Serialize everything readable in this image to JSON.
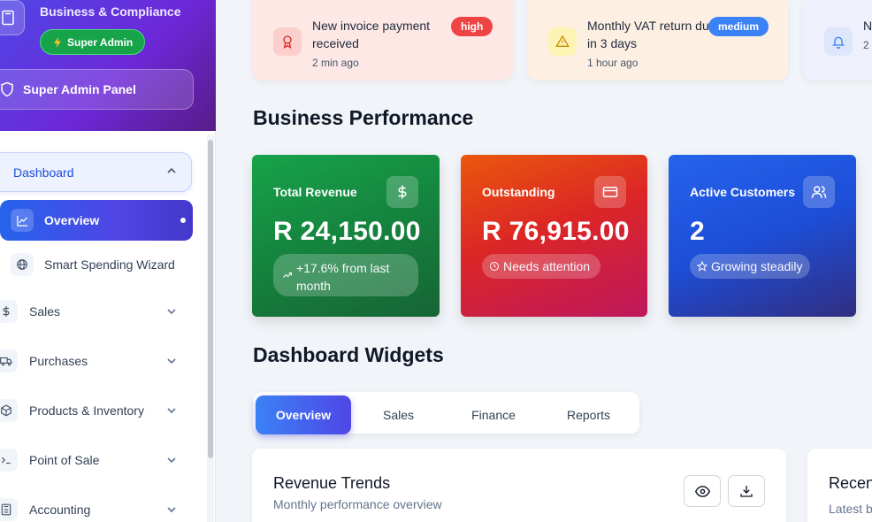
{
  "sidebar": {
    "brand_subtitle": "Business & Compliance",
    "role_badge": "Super Admin",
    "admin_panel_label": "Super Admin Panel",
    "dashboard_label": "Dashboard",
    "overview_label": "Overview",
    "wizard_label": "Smart Spending Wizard",
    "items": [
      {
        "label": "Sales",
        "icon": "dollar-icon"
      },
      {
        "label": "Purchases",
        "icon": "truck-icon"
      },
      {
        "label": "Products & Inventory",
        "icon": "box-icon"
      },
      {
        "label": "Point of Sale",
        "icon": "terminal-icon"
      },
      {
        "label": "Accounting",
        "icon": "calculator-icon"
      }
    ]
  },
  "notifications": [
    {
      "title": "New invoice payment received",
      "time": "2 min ago",
      "priority": "high",
      "icon": "award-icon",
      "bg": "#fde8e6",
      "priority_color": "#ef4444"
    },
    {
      "title": "Monthly VAT return due in 3 days",
      "time": "1 hour ago",
      "priority": "medium",
      "icon": "warning-icon",
      "bg": "#fdf0e3",
      "priority_color": "#3b82f6"
    },
    {
      "title": "N",
      "time": "2",
      "icon": "bell-icon",
      "bg": "#eef1fb"
    }
  ],
  "performance": {
    "title": "Business Performance",
    "cards": [
      {
        "label": "Total Revenue",
        "value": "R 24,150.00",
        "note": "+17.6% from last month",
        "icon": "dollar-icon"
      },
      {
        "label": "Outstanding",
        "value": "R 76,915.00",
        "note": "Needs attention",
        "icon": "credit-card-icon"
      },
      {
        "label": "Active Customers",
        "value": "2",
        "note": "Growing steadily",
        "icon": "users-icon"
      }
    ]
  },
  "widgets": {
    "title": "Dashboard Widgets",
    "tabs": [
      "Overview",
      "Sales",
      "Finance",
      "Reports"
    ],
    "active_tab": "Overview",
    "revenue_card": {
      "title": "Revenue Trends",
      "subtitle": "Monthly performance overview"
    },
    "recent_card": {
      "title": "Recent",
      "subtitle": "Latest b"
    }
  },
  "colors": {
    "accent": "#4f46e5",
    "revenue": "#16a34a",
    "outstanding": "#dc2626",
    "customers": "#2563eb"
  }
}
